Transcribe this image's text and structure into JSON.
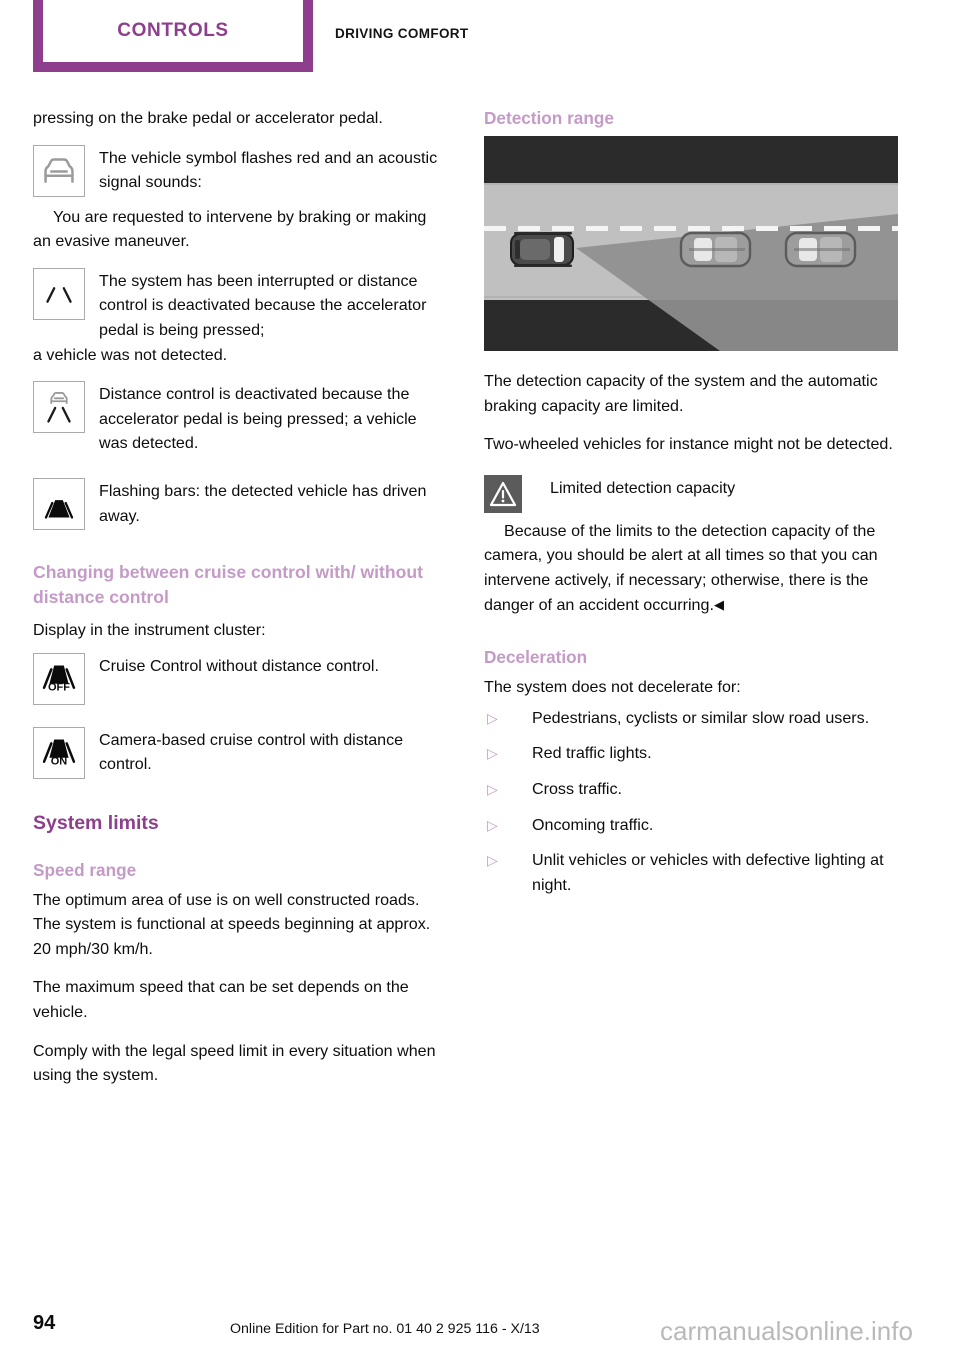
{
  "header": {
    "chapter": "CONTROLS",
    "section": "DRIVING COMFORT"
  },
  "colors": {
    "accent_dark": "#8d3f8e",
    "accent_light": "#c49ac6",
    "text": "#0d0d0d"
  },
  "left_column": {
    "intro_paragraph": "pressing on the brake pedal or accelerator pedal.",
    "symbol_items": [
      {
        "icon": "car-front-symbol",
        "text": "The vehicle symbol flashes red and an acoustic signal sounds:",
        "continuation": "You are requested to intervene by braking or making an evasive maneuver."
      },
      {
        "icon": "lane-lines-symbol",
        "text": "The system has been interrupted or distance control is deactivated because the accelerator pedal is being pressed;",
        "continuation": "a vehicle was not detected."
      },
      {
        "icon": "car-with-lane-lines-symbol",
        "text": "Distance control is deactivated because the accelerator pedal is being pressed; a vehicle was detected.",
        "continuation": ""
      },
      {
        "icon": "filled-lane-bars-symbol",
        "text": "Flashing bars: the detected vehicle has driven away.",
        "continuation": ""
      }
    ],
    "heading_changing": "Changing between cruise control with/ without distance control",
    "display_line": "Display in the instrument cluster:",
    "cluster_items": [
      {
        "icon": "lane-off-symbol",
        "label": "OFF",
        "text": "Cruise Control without distance control."
      },
      {
        "icon": "lane-on-symbol",
        "label": "ON",
        "text": "Camera-based cruise control with distance control."
      }
    ],
    "heading_system_limits": "System limits",
    "heading_speed_range": "Speed range",
    "speed_paragraphs": [
      "The optimum area of use is on well constructed roads. The system is functional at speeds beginning at approx. 20 mph/30 km/h.",
      "The maximum speed that can be set depends on the vehicle.",
      "Comply with the legal speed limit in every situation when using the system."
    ]
  },
  "right_column": {
    "heading_detection_range": "Detection range",
    "figure": {
      "name": "detection-range-diagram",
      "description": "Top-down view of a road: ego vehicle at left with a widening gray detection cone reaching two vehicles ahead, dashed lane marking across the middle."
    },
    "paragraphs": [
      "The detection capacity of the system and the automatic braking capacity are limited.",
      "Two-wheeled vehicles for instance might not be detected."
    ],
    "warning": {
      "icon": "warning-triangle-icon",
      "title": "Limited detection capacity",
      "body": "Because of the limits to the detection capacity of the camera, you should be alert at all times so that you can intervene actively, if necessary; otherwise, there is the danger of an accident occurring.",
      "end_marker": "◀"
    },
    "heading_deceleration": "Deceleration",
    "deceleration_intro": "The system does not decelerate for:",
    "bullet_marker": "▷",
    "bullets": [
      "Pedestrians, cyclists or similar slow road users.",
      "Red traffic lights.",
      "Cross traffic.",
      "Oncoming traffic.",
      "Unlit vehicles or vehicles with defective lighting at night."
    ]
  },
  "footer": {
    "page_number": "94",
    "edition": "Online Edition for Part no. 01 40 2 925 116 - X/13",
    "watermark": "carmanualsonline.info"
  }
}
